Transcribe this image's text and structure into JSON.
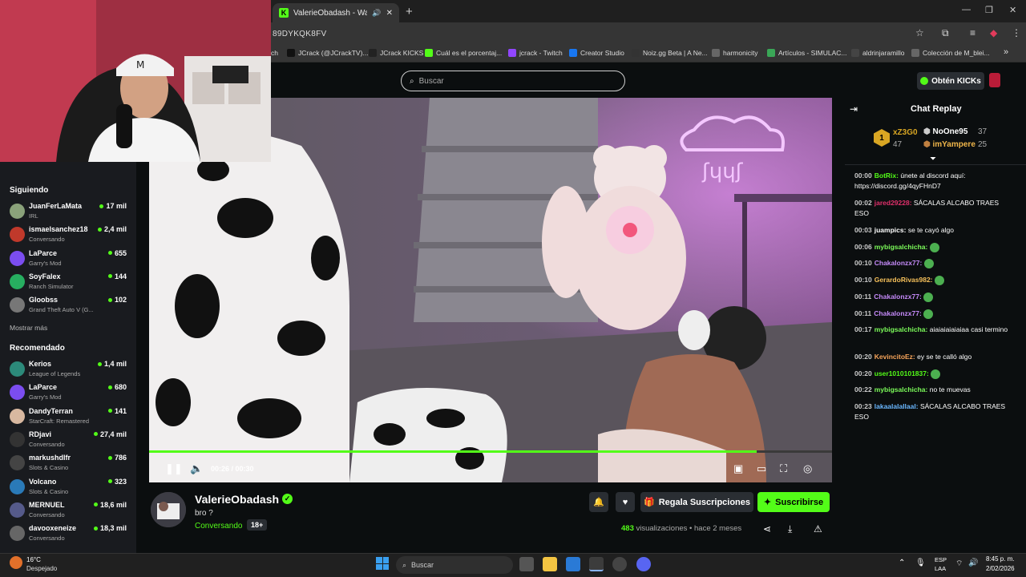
{
  "browser": {
    "tab_title": "ValerieObadash - Watch cl...",
    "url": "89DYKQK8FV",
    "bookmarks": [
      "ch",
      "JCrack (@JCrackTV)...",
      "JCrack KICKS",
      "Cuál es el porcentaj...",
      "jcrack - Twitch",
      "Creator Studio",
      "Noiz.gg Beta | A Ne...",
      "harmonicity",
      "Artículos - SIMULAC...",
      "aldrinjaramillo",
      "Colección de M_blei..."
    ]
  },
  "header": {
    "search_placeholder": "Buscar",
    "get_kicks_label": "Obtén KICKs"
  },
  "sidebar": {
    "following_title": "Siguiendo",
    "following": [
      {
        "name": "JuanFerLaMata",
        "category": "IRL",
        "viewers": "17 mil",
        "color": "#8aa27a"
      },
      {
        "name": "ismaelsanchez18",
        "category": "Conversando",
        "viewers": "2,4 mil",
        "color": "#c0392b"
      },
      {
        "name": "LaParce",
        "category": "Garry's Mod",
        "viewers": "655",
        "color": "#7b4df0"
      },
      {
        "name": "SoyFalex",
        "category": "Ranch Simulator",
        "viewers": "144",
        "color": "#27ae60"
      },
      {
        "name": "Gloobss",
        "category": "Grand Theft Auto V (G...",
        "viewers": "102",
        "color": "#777777"
      }
    ],
    "show_more": "Mostrar más",
    "recommended_title": "Recomendado",
    "recommended": [
      {
        "name": "Kerios",
        "category": "League of Legends",
        "viewers": "1,4 mil",
        "color": "#2c8a7a"
      },
      {
        "name": "LaParce",
        "category": "Garry's Mod",
        "viewers": "680",
        "color": "#7b4df0"
      },
      {
        "name": "DandyTerran",
        "category": "StarCraft: Remastered",
        "viewers": "141",
        "color": "#d8b8a0"
      },
      {
        "name": "RDjavi",
        "category": "Conversando",
        "viewers": "27,4 mil",
        "color": "#333333"
      },
      {
        "name": "markushdlfr",
        "category": "Slots & Casino",
        "viewers": "786",
        "color": "#444444"
      },
      {
        "name": "Volcano",
        "category": "Slots & Casino",
        "viewers": "323",
        "color": "#2a7ab8"
      },
      {
        "name": "MERNUEL",
        "category": "Conversando",
        "viewers": "18,6 mil",
        "color": "#555a8a"
      },
      {
        "name": "davooxeneize",
        "category": "Conversando",
        "viewers": "18,3 mil",
        "color": "#666666"
      }
    ]
  },
  "player": {
    "current_time": "00:26",
    "duration": "00:30",
    "progress": 0.89
  },
  "stream": {
    "streamer": "ValerieObadash",
    "title": "bro ?",
    "category": "Conversando",
    "age_badge": "18+",
    "gift_label": "Regala Suscripciones",
    "subscribe_label": "Suscribirse",
    "views_count": "483",
    "views_label": "visualizaciones",
    "separator": "•",
    "time_ago": "hace 2 meses"
  },
  "chat": {
    "title": "Chat Replay",
    "leaderboard": [
      {
        "name": "xZ3G0",
        "count": "47"
      },
      {
        "name": "NoOne95",
        "count": "37"
      },
      {
        "name": "imYampere",
        "count": "25"
      }
    ],
    "messages": [
      {
        "time": "00:00",
        "user": "BotRix:",
        "color": "#53fc18",
        "text": "únete al discord aquí: https://discord.gg/4qyFHnD7"
      },
      {
        "time": "00:02",
        "user": "jared29228:",
        "color": "#e0306b",
        "text": "SÁCALAS ALCABO TRAES ESO"
      },
      {
        "time": "00:03",
        "user": "juampics:",
        "color": "#ffffff",
        "text": "se te cayó algo"
      },
      {
        "time": "00:06",
        "user": "mybigsalchicha:",
        "color": "#7cfc5a",
        "text": ""
      },
      {
        "time": "00:10",
        "user": "Chakalonzx77:",
        "color": "#c58af9",
        "text": ""
      },
      {
        "time": "00:10",
        "user": "GerardoRivas982:",
        "color": "#f6c05a",
        "text": ""
      },
      {
        "time": "00:11",
        "user": "Chakalonzx77:",
        "color": "#c58af9",
        "text": ""
      },
      {
        "time": "00:11",
        "user": "Chakalonzx77:",
        "color": "#c58af9",
        "text": ""
      },
      {
        "time": "00:17",
        "user": "mybigsalchicha:",
        "color": "#7cfc5a",
        "text": "aiaiaiaiaiaiaa casi termino"
      },
      {
        "time": "00:20",
        "user": "KevincitoEz:",
        "color": "#f7a45a",
        "text": "ey se te calló algo"
      },
      {
        "time": "00:20",
        "user": "user1010101837:",
        "color": "#53fc18",
        "text": ""
      },
      {
        "time": "00:22",
        "user": "mybigsalchicha:",
        "color": "#7cfc5a",
        "text": "no te muevas"
      },
      {
        "time": "00:23",
        "user": "lakaalalallaal:",
        "color": "#6ab7ff",
        "text": "SÁCALAS ALCABO TRAES ESO"
      }
    ]
  },
  "taskbar": {
    "temp": "16°C",
    "weather": "Despejado",
    "search": "Buscar",
    "lang1": "ESP",
    "lang2": "LAA",
    "time": "8:45 p. m.",
    "date": "2/02/2026"
  },
  "colors": {
    "accent": "#53fc18",
    "bg": "#0b0e0f",
    "sidebar": "#191b1f"
  }
}
